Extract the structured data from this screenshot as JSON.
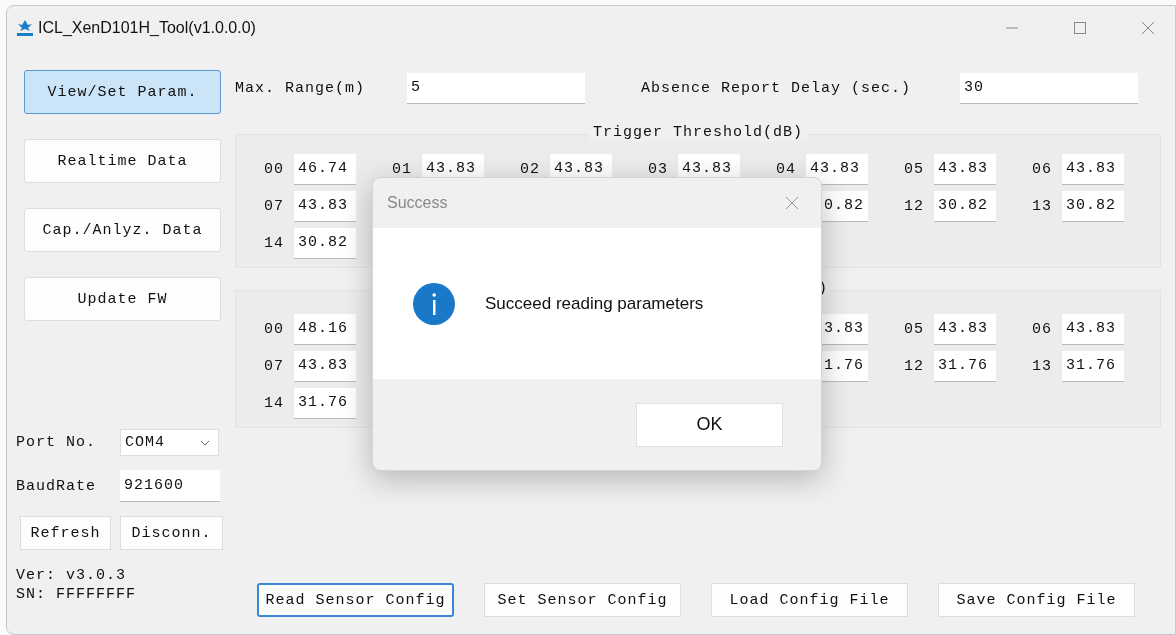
{
  "window": {
    "title": "ICL_XenD101H_Tool(v1.0.0.0)"
  },
  "nav": [
    {
      "label": "View/Set Param.",
      "selected": true
    },
    {
      "label": "Realtime Data",
      "selected": false
    },
    {
      "label": "Cap./Anlyz. Data",
      "selected": false
    },
    {
      "label": "Update FW",
      "selected": false
    }
  ],
  "max_range": {
    "label": "Max. Range(m)",
    "value": "5"
  },
  "absence_delay": {
    "label": "Absence Report Delay (sec.)",
    "value": "30"
  },
  "threshold_groups": [
    {
      "title": "Trigger Threshold(dB)",
      "rows": [
        {
          "left": [
            {
              "label": "00",
              "value": "46.74"
            },
            {
              "label": "01",
              "value": "43.83"
            },
            {
              "label": "02",
              "value": "43.83"
            },
            {
              "label": "03",
              "value": "43.83"
            },
            {
              "label": "04",
              "value": "43.83"
            },
            {
              "label": "05",
              "value": "43.83"
            },
            {
              "label": "06",
              "value": "43.83"
            }
          ],
          "right": []
        },
        {
          "left": [
            {
              "label": "07",
              "value": "43.83"
            }
          ],
          "right": [
            {
              "value": "0.82"
            },
            {
              "label": "12",
              "value": "30.82"
            },
            {
              "label": "13",
              "value": "30.82"
            }
          ]
        },
        {
          "left": [
            {
              "label": "14",
              "value": "30.82"
            }
          ],
          "right": []
        }
      ]
    },
    {
      "title": ")",
      "rows": [
        {
          "left": [
            {
              "label": "00",
              "value": "48.16"
            }
          ],
          "right": [
            {
              "value": "3.83"
            },
            {
              "label": "05",
              "value": "43.83"
            },
            {
              "label": "06",
              "value": "43.83"
            }
          ]
        },
        {
          "left": [
            {
              "label": "07",
              "value": "43.83"
            }
          ],
          "right": [
            {
              "value": "1.76"
            },
            {
              "label": "12",
              "value": "31.76"
            },
            {
              "label": "13",
              "value": "31.76"
            }
          ]
        },
        {
          "left": [
            {
              "label": "14",
              "value": "31.76"
            }
          ],
          "right": []
        }
      ]
    }
  ],
  "port": {
    "label": "Port No.",
    "value": "COM4"
  },
  "baud": {
    "label": "BaudRate",
    "value": "921600"
  },
  "conn_buttons": [
    "Refresh",
    "Disconn."
  ],
  "version": "Ver: v3.0.3",
  "serial": "SN: FFFFFFFF",
  "actions": [
    {
      "label": "Read Sensor Config",
      "focused": true
    },
    {
      "label": "Set Sensor Config",
      "focused": false
    },
    {
      "label": "Load Config File",
      "focused": false
    },
    {
      "label": "Save Config File",
      "focused": false
    }
  ],
  "dialog": {
    "title": "Success",
    "message": "Succeed reading parameters",
    "button": "OK"
  }
}
